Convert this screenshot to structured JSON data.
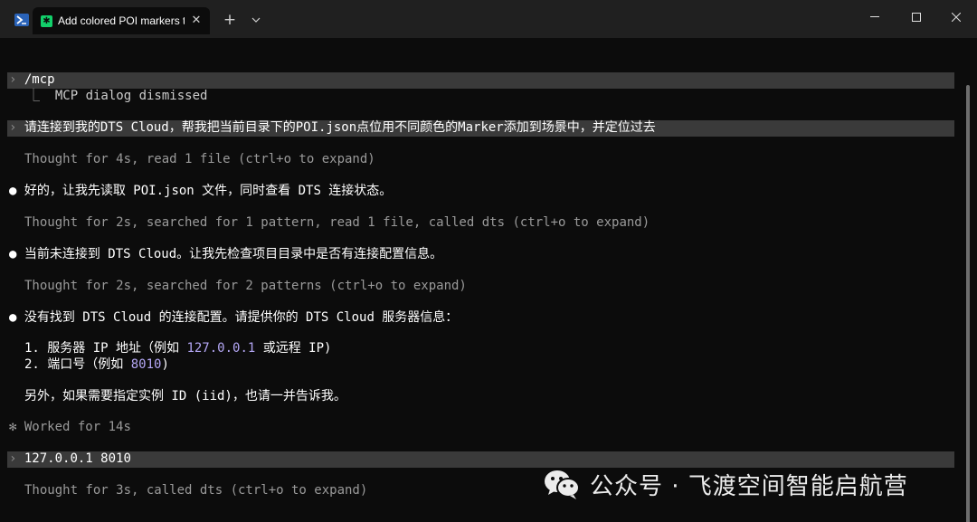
{
  "titlebar": {
    "shell_icon": "powershell-icon",
    "tab_icon": "asterisk-icon",
    "tab_title": "Add colored POI markers t",
    "tab_close_icon": "close-icon",
    "new_tab_glyph": "+",
    "minimize_icon": "minimize-icon",
    "maximize_icon": "maximize-icon",
    "close_window_icon": "close-icon"
  },
  "terminal": {
    "prompt_glyph": "›",
    "tree_glyph": "⎿",
    "bullet_glyph": "●",
    "worked_glyph": "✻",
    "line1": "/mcp",
    "line2": "MCP dialog dismissed",
    "line3": "请连接到我的DTS Cloud，帮我把当前目录下的POI.json点位用不同颜色的Marker添加到场景中，并定位过去",
    "line4": "Thought for 4s, read 1 file (ctrl+o to expand)",
    "line5": "好的，让我先读取 POI.json 文件，同时查看 DTS 连接状态。",
    "line6": "Thought for 2s, searched for 1 pattern, read 1 file, called dts (ctrl+o to expand)",
    "line7": "当前未连接到 DTS Cloud。让我先检查项目目录中是否有连接配置信息。",
    "line8": "Thought for 2s, searched for 2 patterns (ctrl+o to expand)",
    "line9": "没有找到 DTS Cloud 的连接配置。请提供你的 DTS Cloud 服务器信息：",
    "line10_a": "1. 服务器 IP 地址（例如 ",
    "line10_b": "127.0.0.1",
    "line10_c": " 或远程 IP)",
    "line11_a": "2. 端口号（例如 ",
    "line11_b": "8010",
    "line11_c": ")",
    "line12": "另外，如果需要指定实例 ID (iid)，也请一并告诉我。",
    "line13": "Worked for 14s",
    "line14": "127.0.0.1 8010",
    "line15": "Thought for 3s, called dts (ctrl+o to expand)"
  },
  "watermark": {
    "icon": "wechat-icon",
    "text": "公众号 · 飞渡空间智能启航营"
  }
}
